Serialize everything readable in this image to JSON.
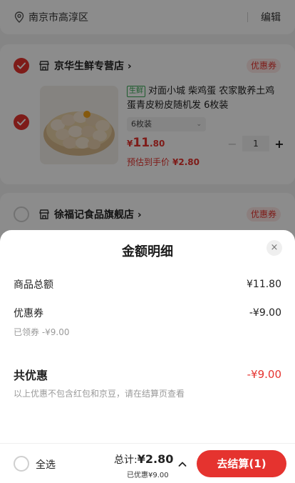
{
  "location": {
    "text": "南京市高淳区",
    "edit_label": "编辑"
  },
  "stores": [
    {
      "name": "京华生鲜专营店 ›",
      "coupon_label": "优惠券",
      "checked": true,
      "item": {
        "fresh_tag": "生鲜",
        "title": "对面小城 柴鸡蛋 农家散养土鸡蛋青皮粉皮随机发 6枚装",
        "spec": "6枚装",
        "price_symbol": "¥",
        "price_int": "11",
        "price_dec": ".80",
        "estimate_label": "预估到手价",
        "estimate_value": "¥2.80",
        "quantity": "1"
      }
    },
    {
      "name": "徐福记食品旗舰店 ›",
      "coupon_label": "优惠券",
      "checked": false
    }
  ],
  "sheet": {
    "title": "金额明细",
    "close_icon": "×",
    "rows": [
      {
        "label": "商品总额",
        "value": "¥11.80"
      },
      {
        "label": "优惠券",
        "value": "-¥9.00"
      }
    ],
    "coupon_sub": "已领券 -¥9.00",
    "total_discount_label": "共优惠",
    "total_discount_value": "-¥9.00",
    "note": "以上优惠不包含红包和京豆，请在结算页查看"
  },
  "bottom": {
    "select_all_label": "全选",
    "total_label": "总计:",
    "total_value": "¥2.80",
    "saved_text": "已优惠¥9.00",
    "checkout_label": "去结算(1)"
  },
  "colors": {
    "accent": "#e5332f",
    "fresh_green": "#35a852"
  }
}
